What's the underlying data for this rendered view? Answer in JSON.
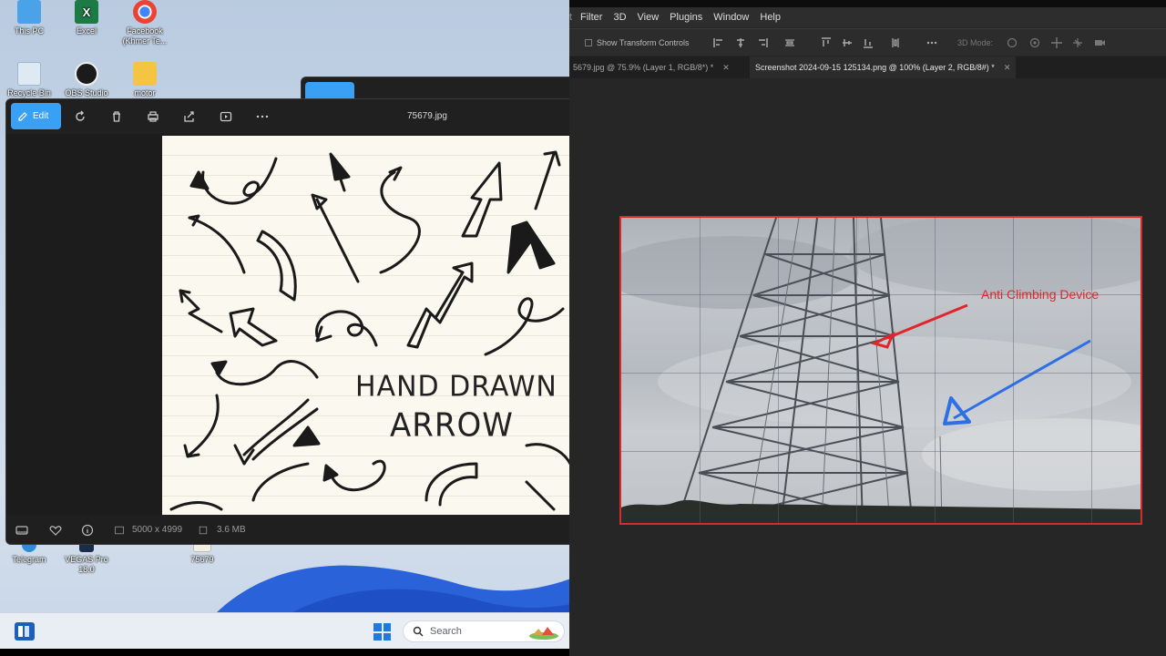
{
  "desktop": {
    "icons": [
      {
        "label": "This PC"
      },
      {
        "label": "Excel"
      },
      {
        "label": "Facebook (Khmer Te..."
      },
      {
        "label": "Recycle Bin"
      },
      {
        "label": "OBS Studio"
      },
      {
        "label": "motor"
      },
      {
        "label": "Telegram"
      },
      {
        "label": "VEGAS Pro 18.0"
      },
      {
        "label": "75679"
      }
    ],
    "taskbar": {
      "search_placeholder": "Search"
    }
  },
  "photo_viewer": {
    "edit_label": "Edit",
    "title": "75679.jpg",
    "image_text_line1": "HAND DRAWN",
    "image_text_line2": "ARROW",
    "dimensions": "5000 x 4999",
    "file_size": "3.6 MB",
    "toolbar_icons": [
      "rotate-icon",
      "delete-icon",
      "print-icon",
      "share-icon",
      "slideshow-icon",
      "more-icon"
    ]
  },
  "photoshop": {
    "menu": [
      "Filter",
      "3D",
      "View",
      "Plugins",
      "Window",
      "Help"
    ],
    "options": {
      "show_transform_controls": "Show Transform Controls",
      "mode_3d": "3D Mode:"
    },
    "tabs": [
      {
        "label": "5679.jpg @ 75.9% (Layer 1, RGB/8*) *",
        "active": false
      },
      {
        "label": "Screenshot 2024-09-15 125134.png @ 100% (Layer 2, RGB/8#) *",
        "active": true
      }
    ],
    "annotation_label": "Anti Climbing Device",
    "colors": {
      "annotation_red": "#e0262b",
      "arrow_blue": "#2e6fe6",
      "selection_border": "#d62b2b"
    }
  }
}
